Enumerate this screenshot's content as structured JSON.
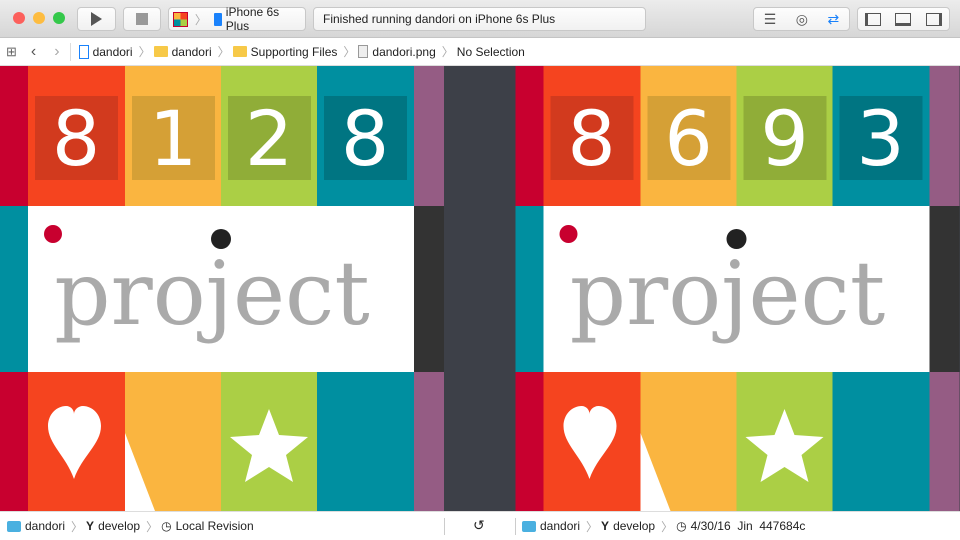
{
  "toolbar": {
    "scheme_device": "iPhone 6s Plus",
    "status": "Finished running dandori on iPhone 6s Plus"
  },
  "jump_bar": {
    "items": [
      "dandori",
      "dandori",
      "Supporting Files",
      "dandori.png",
      "No Selection"
    ]
  },
  "left_image": {
    "digits": [
      "8",
      "1",
      "2",
      "8"
    ],
    "word": "project"
  },
  "right_image": {
    "digits": [
      "8",
      "6",
      "9",
      "3"
    ],
    "word": "project"
  },
  "bottom_bar": {
    "left": {
      "project": "dandori",
      "branch": "develop",
      "revision": "Local Revision"
    },
    "right": {
      "project": "dandori",
      "branch": "develop",
      "revision": "4/30/16  Jin  447684c"
    }
  },
  "colors": {
    "crimson": "#c8002f",
    "orange": "#f5441f",
    "yellow": "#fab540",
    "green": "#abcf45",
    "teal": "#008fa0",
    "purple": "#955c84",
    "accent": "#1a82fb"
  }
}
